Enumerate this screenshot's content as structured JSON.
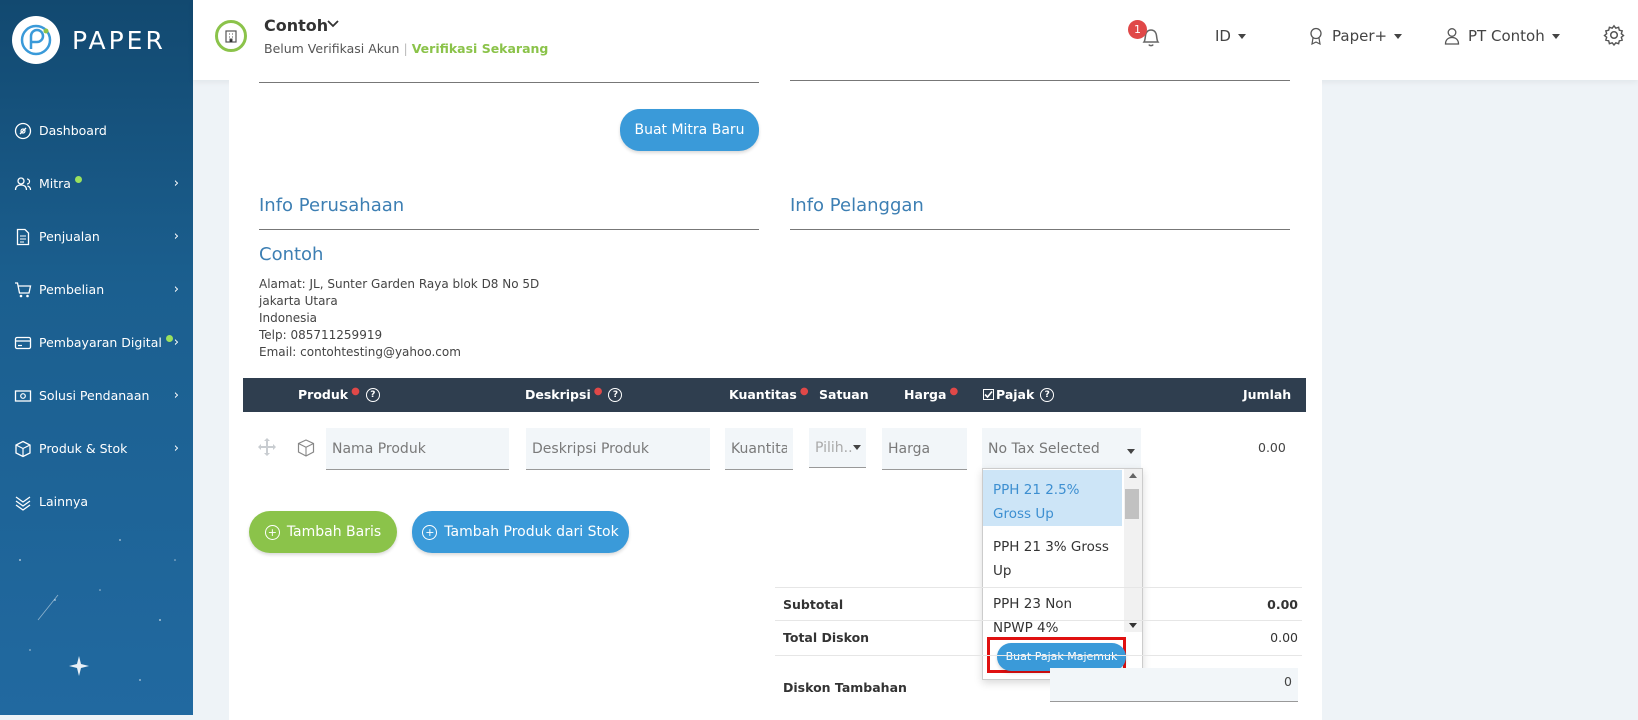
{
  "sidebar": {
    "brand": "PAPER",
    "items": [
      {
        "label": "Dashboard",
        "icon": "dashboard-icon",
        "dot": false,
        "chevron": false
      },
      {
        "label": "Mitra",
        "icon": "users-icon",
        "dot": true,
        "chevron": true
      },
      {
        "label": "Penjualan",
        "icon": "document-icon",
        "dot": false,
        "chevron": true
      },
      {
        "label": "Pembelian",
        "icon": "cart-icon",
        "dot": false,
        "chevron": true
      },
      {
        "label": "Pembayaran Digital",
        "icon": "card-icon",
        "dot": true,
        "chevron": true
      },
      {
        "label": "Solusi Pendanaan",
        "icon": "money-icon",
        "dot": false,
        "chevron": true
      },
      {
        "label": "Produk & Stok",
        "icon": "box-icon",
        "dot": false,
        "chevron": true
      },
      {
        "label": "Lainnya",
        "icon": "layers-icon",
        "dot": false,
        "chevron": false
      }
    ]
  },
  "topbar": {
    "company": "Contoh",
    "verify_status": "Belum Verifikasi Akun",
    "verify_link": "Verifikasi Sekarang",
    "notif_count": "1",
    "language": "ID",
    "plan": "Paper+",
    "user": "PT Contoh"
  },
  "form": {
    "new_partner_button": "Buat Mitra Baru",
    "company_info_title": "Info Perusahaan",
    "customer_info_title": "Info Pelanggan",
    "company_name": "Contoh",
    "address": [
      "Alamat: JL, Sunter Garden Raya blok D8 No 5D",
      "jakarta Utara",
      "Indonesia",
      "Telp: 085711259919",
      "Email: contohtesting@yahoo.com"
    ]
  },
  "table": {
    "headers": {
      "product": "Produk",
      "description": "Deskripsi",
      "quantity": "Kuantitas",
      "unit": "Satuan",
      "price": "Harga",
      "tax": "Pajak",
      "amount": "Jumlah"
    },
    "row": {
      "product_placeholder": "Nama Produk",
      "description_placeholder": "Deskripsi Produk",
      "quantity_placeholder": "Kuantitas",
      "unit_placeholder": "Pilih..",
      "price_placeholder": "Harga",
      "tax_value": "No Tax Selected",
      "amount": "0.00"
    }
  },
  "tax_dropdown": {
    "options": [
      "PPH 21 2.5% Gross Up",
      "PPH 21 3% Gross Up",
      "PPH 23 Non NPWP 4%"
    ],
    "compound_button": "Buat Pajak Majemuk"
  },
  "actions": {
    "add_row": "Tambah Baris",
    "add_from_stock": "Tambah Produk dari Stok"
  },
  "totals": {
    "subtotal_label": "Subtotal",
    "subtotal_value": "0.00",
    "total_discount_label": "Total Diskon",
    "total_discount_value": "0.00",
    "extra_discount_label": "Diskon Tambahan",
    "extra_discount_value": "0"
  },
  "colors": {
    "primary_blue": "#3a9ad9",
    "green": "#8bc34a",
    "header_dark": "#2f3e4f",
    "highlight_red": "#e01010"
  }
}
